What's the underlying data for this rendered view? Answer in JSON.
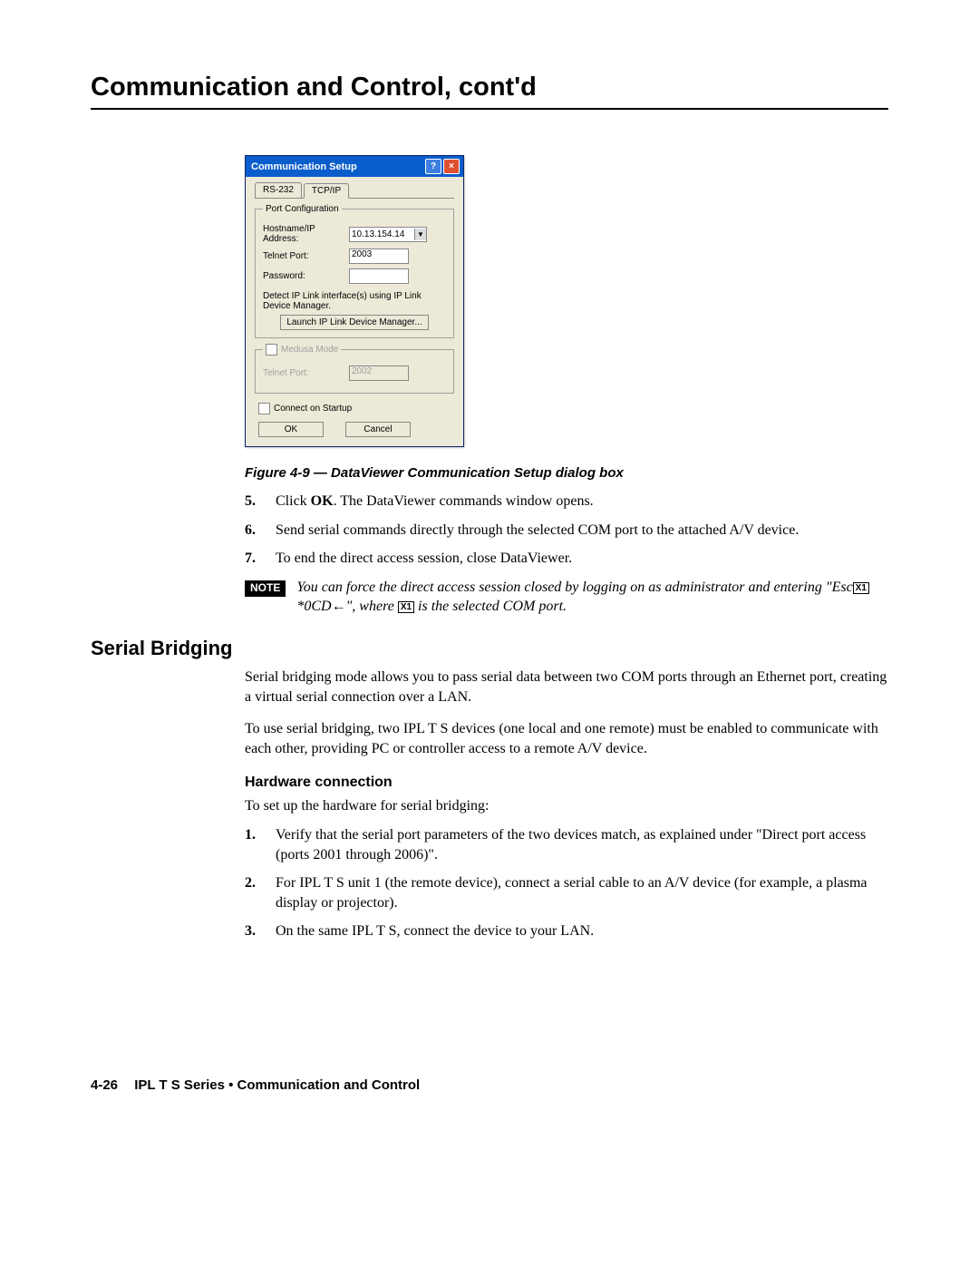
{
  "title": "Communication and Control, cont'd",
  "dialog": {
    "title": "Communication Setup",
    "tabs": {
      "rs232": "RS-232",
      "tcpip": "TCP/IP"
    },
    "port_config_legend": "Port Configuration",
    "hostname_label": "Hostname/IP Address:",
    "hostname_value": "10.13.154.14",
    "telnet_label": "Telnet Port:",
    "telnet_value": "2003",
    "password_label": "Password:",
    "password_value": "",
    "detect_text": "Detect IP Link interface(s) using IP Link Device Manager.",
    "launch_btn": "Launch IP Link Device Manager...",
    "medusa_legend": "Medusa Mode",
    "medusa_telnet_label": "Telnet Port:",
    "medusa_telnet_value": "2002",
    "connect_startup": "Connect on Startup",
    "ok": "OK",
    "cancel": "Cancel"
  },
  "figure_caption": "Figure 4-9 — DataViewer Communication Setup dialog box",
  "steps_a": {
    "s5": {
      "n": "5.",
      "t_pre": "Click ",
      "t_bold": "OK",
      "t_post": ".  The DataViewer commands window opens."
    },
    "s6": {
      "n": "6.",
      "t": "Send serial commands directly through the selected COM port to the attached A/V device."
    },
    "s7": {
      "n": "7.",
      "t": "To end the direct access session, close DataViewer."
    }
  },
  "note": {
    "badge": "NOTE",
    "line1_pre": "You can force the direct access session closed by logging on as administrator and entering \"Esc",
    "x1": "X1",
    "line1_mid": "*0CD",
    "arrow": "←",
    "line1_post": "\", where ",
    "x2": "X1",
    "line1_end": " is the selected COM port."
  },
  "serial": {
    "heading": "Serial Bridging",
    "p1": "Serial bridging mode allows you to pass serial data between two COM ports through an Ethernet port, creating a virtual serial connection over a LAN.",
    "p2": "To use serial bridging, two IPL T S devices (one local and one remote) must be enabled to communicate with each other, providing PC or controller access to a remote A/V device.",
    "hw_heading": "Hardware connection",
    "hw_intro": "To set up the hardware for serial bridging:",
    "s1": {
      "n": "1.",
      "t": "Verify that the serial port parameters of the two devices match, as explained under \"Direct port access (ports 2001 through 2006)\"."
    },
    "s2": {
      "n": "2.",
      "t": "For IPL T S unit 1 (the remote device), connect a serial cable to an A/V device (for example, a plasma display or projector)."
    },
    "s3": {
      "n": "3.",
      "t": "On the same IPL T S, connect the device to your LAN."
    }
  },
  "footer": {
    "page": "4-26",
    "text": "IPL T S Series • Communication and Control"
  }
}
